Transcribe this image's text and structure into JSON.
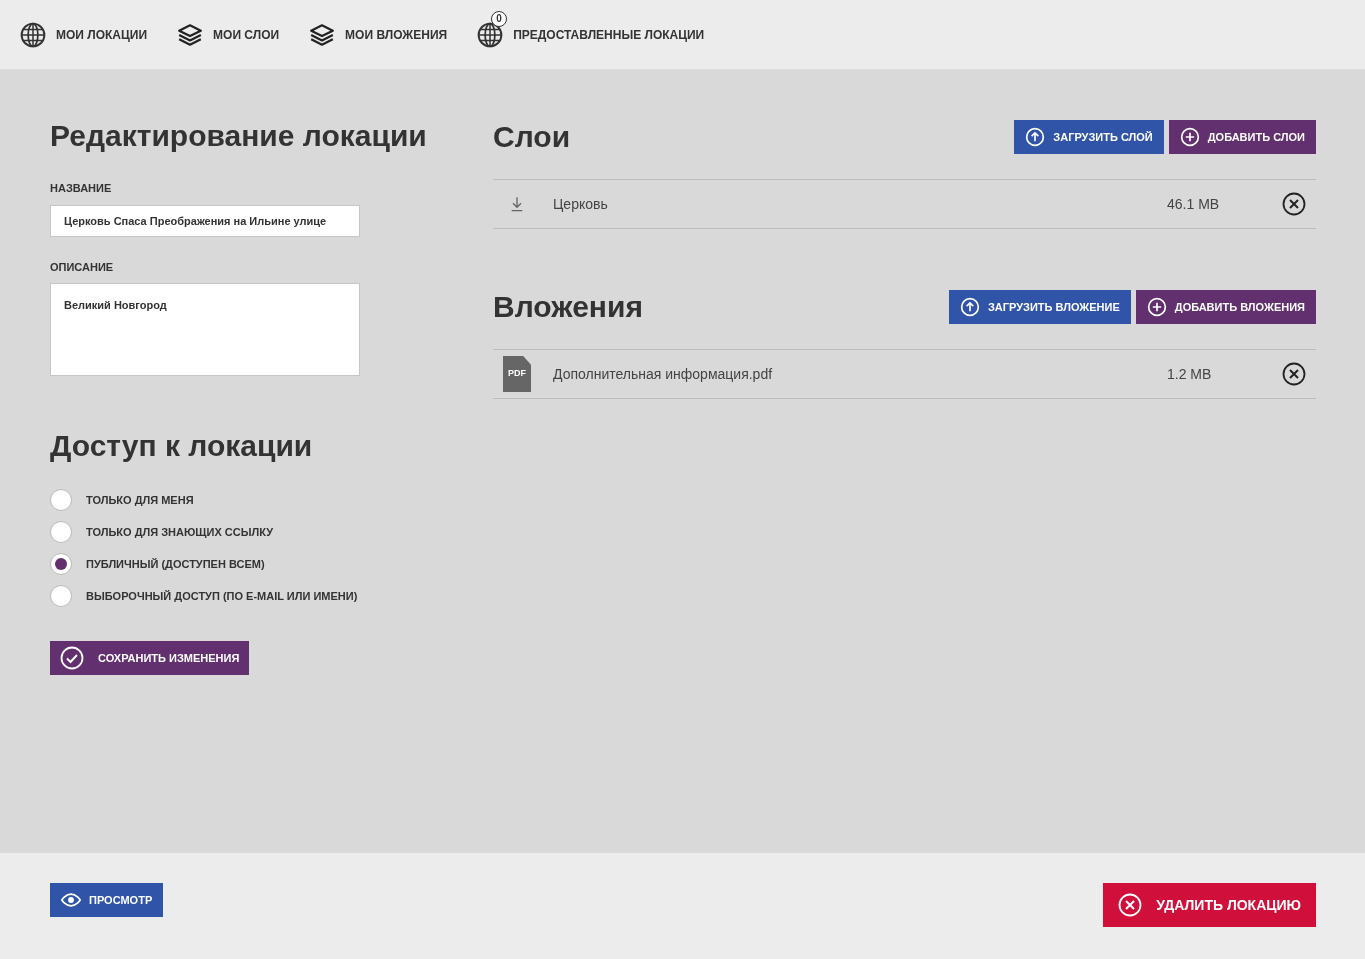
{
  "nav": [
    {
      "kind": "locations",
      "label": "МОИ ЛОКАЦИИ"
    },
    {
      "kind": "layers",
      "label": "МОИ СЛОИ"
    },
    {
      "kind": "layers",
      "label": "МОИ ВЛОЖЕНИЯ"
    },
    {
      "kind": "locations",
      "label": "ПРЕДОСТАВЛЕННЫЕ ЛОКАЦИИ",
      "badge": "0"
    }
  ],
  "edit": {
    "title": "Редактирование локации",
    "name_label": "НАЗВАНИЕ",
    "name_value": "Церковь Спаса Преображения на Ильине улице",
    "description_label": "ОПИСАНИЕ",
    "description_value": "Великий Новгород"
  },
  "access": {
    "title": "Доступ к локации",
    "options": [
      {
        "label": "ТОЛЬКО ДЛЯ МЕНЯ",
        "selected": false
      },
      {
        "label": "ТОЛЬКО ДЛЯ ЗНАЮЩИХ ССЫЛКУ",
        "selected": false
      },
      {
        "label": "ПУБЛИЧНЫЙ (ДОСТУПЕН ВСЕМ)",
        "selected": true
      },
      {
        "label": "ВЫБОРОЧНЫЙ ДОСТУП (ПО E-MAIL ИЛИ ИМЕНИ)",
        "selected": false
      }
    ],
    "save_button": "СОХРАНИТЬ ИЗМЕНЕНИЯ"
  },
  "sections": [
    {
      "title": "Слои",
      "buttons": [
        {
          "kind": "upload",
          "label": "ЗАГРУЗИТЬ СЛОЙ"
        },
        {
          "kind": "add",
          "label": "ДОБАВИТЬ СЛОИ"
        }
      ],
      "items": [
        {
          "kind": "layer",
          "name": "Церковь",
          "size": "46.1 MB"
        }
      ]
    },
    {
      "title": "Вложения",
      "buttons": [
        {
          "kind": "upload",
          "label": "ЗАГРУЗИТЬ ВЛОЖЕНИЕ"
        },
        {
          "kind": "add",
          "label": "ДОБАВИТЬ ВЛОЖЕНИЯ"
        }
      ],
      "items": [
        {
          "kind": "pdf",
          "icon_text": "PDF",
          "name": "Дополнительная информация.pdf",
          "size": "1.2 MB"
        }
      ]
    }
  ],
  "footer": {
    "preview_button": "ПРОСМОТР",
    "delete_button": "УДАЛИТЬ ЛОКАЦИЮ"
  }
}
